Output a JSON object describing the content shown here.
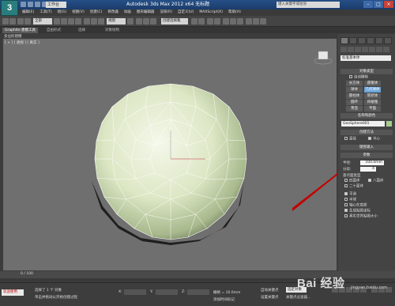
{
  "app": {
    "logo_letter": "3",
    "title": "Autodesk 3ds Max  2012 x64    无标题",
    "workspace": "工作台",
    "search_placeholder": "键入关键字或短语"
  },
  "menu": [
    "编辑(E)",
    "工具(T)",
    "组(G)",
    "视图(V)",
    "创建(C)",
    "修改器",
    "动画",
    "图形编辑器",
    "渲染(R)",
    "自定义(U)",
    "MAXScript(X)",
    "帮助(H)"
  ],
  "toolbar": {
    "selection_filter": "全部",
    "view_dropdown": "视图",
    "named_set": "创建选择集"
  },
  "ribbon": {
    "tabs": [
      "Graphite 建模工具",
      "自由形式",
      "选择",
      "对象绘制"
    ],
    "active_index": 0
  },
  "viewport": {
    "panel_label": "多边形建模",
    "corner_label": "[ + ] [ 透视 ] [ 真实 ]"
  },
  "command_panel": {
    "category_dropdown": "标准基本体",
    "object_type_title": "对象类型",
    "autogrid_label": "自动栅格",
    "buttons": [
      "长方体",
      "圆锥体",
      "球体",
      "几何球体",
      "圆柱体",
      "管状体",
      "圆环",
      "四棱锥",
      "茶壶",
      "平面"
    ],
    "active_button_index": 3,
    "name_color_title": "名称和颜色",
    "object_name": "GeoSphere001",
    "creation_method_title": "创建方法",
    "creation_options": [
      "直径",
      "中心"
    ],
    "keyboard_entry_title": "键盘输入",
    "parameters_title": "参数",
    "radius_label": "半径:",
    "radius_value": "100.0mm",
    "segments_label": "分段:",
    "segments_value": "4",
    "base_type_title": "基点面类型",
    "base_types": [
      "四面体",
      "八面体",
      "二十面体"
    ],
    "options": [
      "平滑",
      "半球",
      "轴心在底部",
      "生成贴图坐标",
      "真实世界贴图大小"
    ],
    "swatch_color": "#a9cc8f"
  },
  "timeline": {
    "frame_label": "0 / 100"
  },
  "status": {
    "maxscript_label": "欢迎使用",
    "line1": "选择了 1 个 对象",
    "line2": "单击并拖动以开始创建过程",
    "x_label": "X:",
    "x_value": "",
    "y_label": "Y:",
    "y_value": "",
    "z_label": "Z:",
    "z_value": "",
    "grid_label": "栅格 = 10.0mm",
    "autokey_label": "自动关键点",
    "autokey_value": "选定对象",
    "setkey_label": "设置关键点",
    "addtime_label": "添加时间标记",
    "keyfilter_label": "关键点过滤器..."
  },
  "watermark": {
    "text": "Bai 经验",
    "sub": "jingyan.baidu.com"
  },
  "colors": {
    "accent": "#68a3d8",
    "annotation": "#c40000",
    "viewport_bg": "#6f6f6f",
    "sphere": "#dfe8c8"
  }
}
